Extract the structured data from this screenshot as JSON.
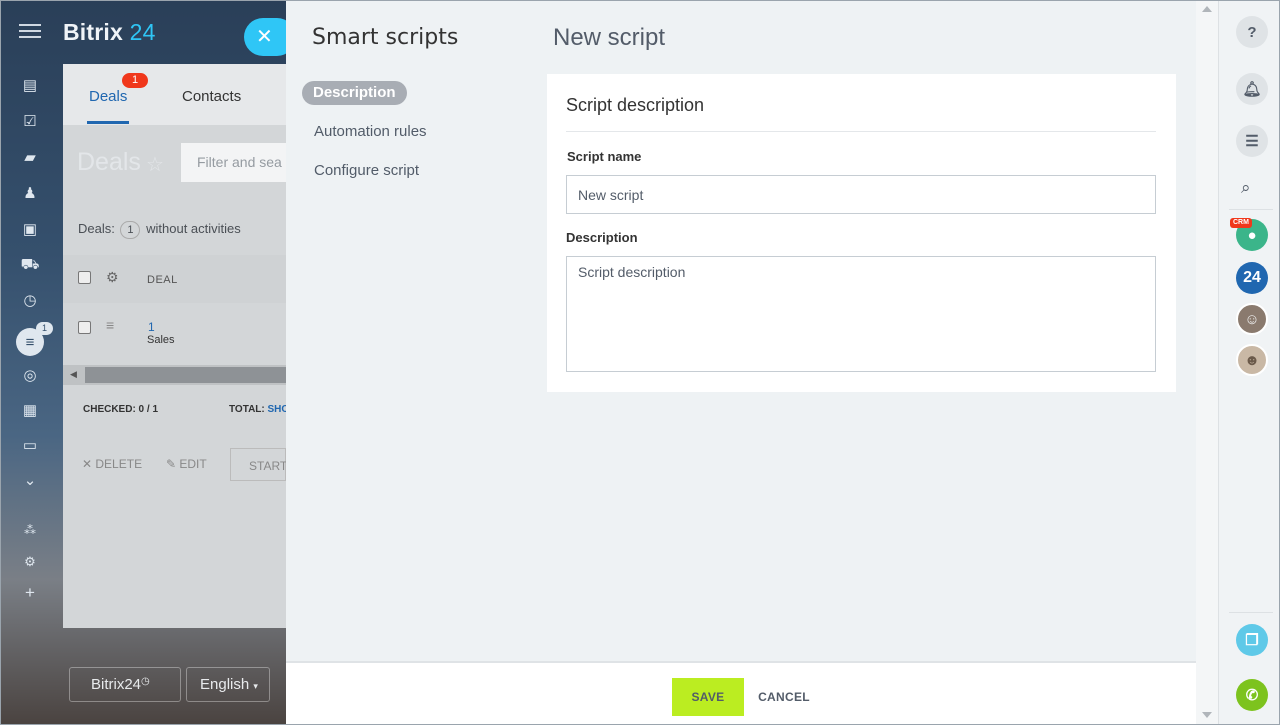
{
  "background": {
    "logo": {
      "name": "Bitrix",
      "num": "24"
    },
    "crm_tabs": {
      "deals": "Deals",
      "deals_badge": "1",
      "contacts": "Contacts"
    },
    "deals_title": "Deals",
    "filter_placeholder": "Filter and sea",
    "counter": {
      "prefix": "Deals:",
      "count": "1",
      "suffix": "without activities"
    },
    "grid": {
      "column_deal": "DEAL",
      "row_id": "1",
      "row_stage": "Sales"
    },
    "checked": "CHECKED: 0 / 1",
    "total_label": "TOTAL:",
    "total_link": "SHO",
    "actions": {
      "delete": "DELETE",
      "edit": "EDIT",
      "start": "START"
    },
    "bottom": {
      "brand": "Bitrix24",
      "language": "English"
    },
    "left_menu_badge": "1"
  },
  "slider": {
    "title": "Smart scripts",
    "nav": [
      {
        "label": "Description"
      },
      {
        "label": "Automation rules"
      },
      {
        "label": "Configure script"
      }
    ],
    "page_heading": "New script",
    "card": {
      "title": "Script description",
      "name_label": "Script name",
      "name_value": "New script",
      "description_label": "Description",
      "description_placeholder": "Script description"
    },
    "footer": {
      "save": "SAVE",
      "cancel": "CANCEL"
    }
  },
  "right_bar": {
    "help": "?",
    "crm_badge": "CRM",
    "b24_label": "24"
  },
  "colors": {
    "accent": "#2fc6f6",
    "save_button": "#bbed21",
    "link_blue": "#2067b0",
    "badge_red": "#f0371b"
  }
}
